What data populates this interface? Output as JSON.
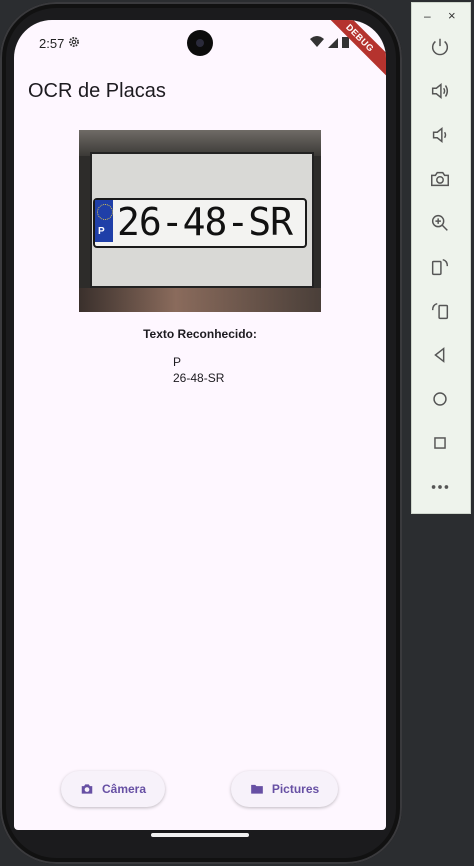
{
  "status_bar": {
    "time": "2:57",
    "debug_banner": "DEBUG"
  },
  "app": {
    "title": "OCR de Placas"
  },
  "image": {
    "plate_number": "26-48-SR",
    "plate_country": "P"
  },
  "result": {
    "heading": "Texto Reconhecido:",
    "lines": [
      "P",
      "26-48-SR"
    ]
  },
  "buttons": {
    "camera": "Câmera",
    "pictures": "Pictures"
  },
  "icons": {
    "camera_button": "camera-icon",
    "pictures_button": "folder-icon",
    "toolbar": [
      "power-icon",
      "volume-up-icon",
      "volume-down-icon",
      "screenshot-icon",
      "zoom-icon",
      "rotate-left-icon",
      "rotate-right-icon",
      "back-icon",
      "home-icon",
      "overview-icon",
      "more-icon"
    ]
  },
  "colors": {
    "accent": "#6750a4",
    "screen_bg": "#fef7ff",
    "debug_banner": "#b5332e"
  },
  "toolbar": {
    "minimize": "–",
    "close": "×"
  }
}
